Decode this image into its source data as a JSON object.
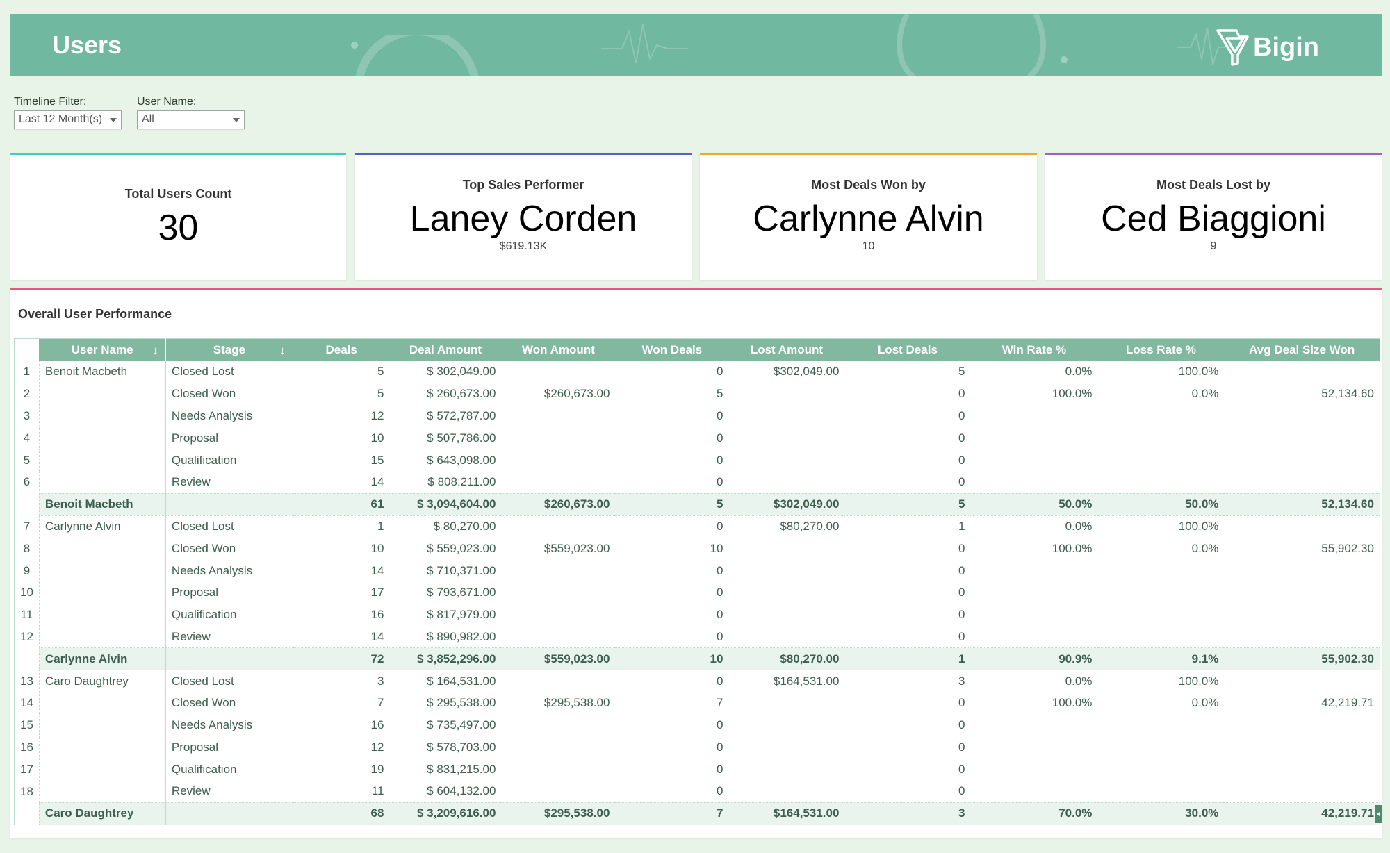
{
  "header": {
    "title": "Users",
    "brand": "Bigin",
    "brand_icon": "funnel-logo-icon",
    "bg_color": "#70b8a0"
  },
  "filters": {
    "timeline": {
      "label": "Timeline Filter:",
      "value": "Last 12 Month(s)"
    },
    "user_name": {
      "label": "User Name:",
      "value": "All"
    }
  },
  "cards": [
    {
      "title": "Total Users Count",
      "value": "30",
      "sub": "",
      "accent": "#3ecfc0"
    },
    {
      "title": "Top Sales Performer",
      "value": "Laney Corden",
      "sub": "$619.13K",
      "accent": "#5560c8"
    },
    {
      "title": "Most Deals Won by",
      "value": "Carlynne Alvin",
      "sub": "10",
      "accent": "#f5a623"
    },
    {
      "title": "Most Deals Lost by",
      "value": "Ced Biaggioni",
      "sub": "9",
      "accent": "#9b5fd6"
    }
  ],
  "panel": {
    "title": "Overall User Performance",
    "accent": "#e5577f",
    "columns": [
      "User Name",
      "Stage",
      "Deals",
      "Deal Amount",
      "Won Amount",
      "Won Deals",
      "Lost Amount",
      "Lost Deals",
      "Win Rate %",
      "Loss Rate %",
      "Avg Deal Size Won"
    ],
    "rows": [
      {
        "type": "row",
        "n": "1",
        "user": "Benoit Macbeth",
        "stage": "Closed Lost",
        "deals": "5",
        "deal_amount": "$ 302,049.00",
        "won_amount": "",
        "won_deals": "0",
        "lost_amount": "$302,049.00",
        "lost_deals": "5",
        "win_rate": "0.0%",
        "loss_rate": "100.0%",
        "avg": ""
      },
      {
        "type": "row",
        "n": "2",
        "user": "",
        "stage": "Closed Won",
        "deals": "5",
        "deal_amount": "$ 260,673.00",
        "won_amount": "$260,673.00",
        "won_deals": "5",
        "lost_amount": "",
        "lost_deals": "0",
        "win_rate": "100.0%",
        "loss_rate": "0.0%",
        "avg": "52,134.60"
      },
      {
        "type": "row",
        "n": "3",
        "user": "",
        "stage": "Needs Analysis",
        "deals": "12",
        "deal_amount": "$ 572,787.00",
        "won_amount": "",
        "won_deals": "0",
        "lost_amount": "",
        "lost_deals": "0",
        "win_rate": "",
        "loss_rate": "",
        "avg": ""
      },
      {
        "type": "row",
        "n": "4",
        "user": "",
        "stage": "Proposal",
        "deals": "10",
        "deal_amount": "$ 507,786.00",
        "won_amount": "",
        "won_deals": "0",
        "lost_amount": "",
        "lost_deals": "0",
        "win_rate": "",
        "loss_rate": "",
        "avg": ""
      },
      {
        "type": "row",
        "n": "5",
        "user": "",
        "stage": "Qualification",
        "deals": "15",
        "deal_amount": "$ 643,098.00",
        "won_amount": "",
        "won_deals": "0",
        "lost_amount": "",
        "lost_deals": "0",
        "win_rate": "",
        "loss_rate": "",
        "avg": ""
      },
      {
        "type": "row",
        "n": "6",
        "user": "",
        "stage": "Review",
        "deals": "14",
        "deal_amount": "$ 808,211.00",
        "won_amount": "",
        "won_deals": "0",
        "lost_amount": "",
        "lost_deals": "0",
        "win_rate": "",
        "loss_rate": "",
        "avg": ""
      },
      {
        "type": "sub",
        "n": "",
        "user": "Benoit Macbeth",
        "stage": "",
        "deals": "61",
        "deal_amount": "$ 3,094,604.00",
        "won_amount": "$260,673.00",
        "won_deals": "5",
        "lost_amount": "$302,049.00",
        "lost_deals": "5",
        "win_rate": "50.0%",
        "loss_rate": "50.0%",
        "avg": "52,134.60"
      },
      {
        "type": "row",
        "n": "7",
        "user": "Carlynne Alvin",
        "stage": "Closed Lost",
        "deals": "1",
        "deal_amount": "$ 80,270.00",
        "won_amount": "",
        "won_deals": "0",
        "lost_amount": "$80,270.00",
        "lost_deals": "1",
        "win_rate": "0.0%",
        "loss_rate": "100.0%",
        "avg": ""
      },
      {
        "type": "row",
        "n": "8",
        "user": "",
        "stage": "Closed Won",
        "deals": "10",
        "deal_amount": "$ 559,023.00",
        "won_amount": "$559,023.00",
        "won_deals": "10",
        "lost_amount": "",
        "lost_deals": "0",
        "win_rate": "100.0%",
        "loss_rate": "0.0%",
        "avg": "55,902.30"
      },
      {
        "type": "row",
        "n": "9",
        "user": "",
        "stage": "Needs Analysis",
        "deals": "14",
        "deal_amount": "$ 710,371.00",
        "won_amount": "",
        "won_deals": "0",
        "lost_amount": "",
        "lost_deals": "0",
        "win_rate": "",
        "loss_rate": "",
        "avg": ""
      },
      {
        "type": "row",
        "n": "10",
        "user": "",
        "stage": "Proposal",
        "deals": "17",
        "deal_amount": "$ 793,671.00",
        "won_amount": "",
        "won_deals": "0",
        "lost_amount": "",
        "lost_deals": "0",
        "win_rate": "",
        "loss_rate": "",
        "avg": ""
      },
      {
        "type": "row",
        "n": "11",
        "user": "",
        "stage": "Qualification",
        "deals": "16",
        "deal_amount": "$ 817,979.00",
        "won_amount": "",
        "won_deals": "0",
        "lost_amount": "",
        "lost_deals": "0",
        "win_rate": "",
        "loss_rate": "",
        "avg": ""
      },
      {
        "type": "row",
        "n": "12",
        "user": "",
        "stage": "Review",
        "deals": "14",
        "deal_amount": "$ 890,982.00",
        "won_amount": "",
        "won_deals": "0",
        "lost_amount": "",
        "lost_deals": "0",
        "win_rate": "",
        "loss_rate": "",
        "avg": ""
      },
      {
        "type": "sub",
        "n": "",
        "user": "Carlynne Alvin",
        "stage": "",
        "deals": "72",
        "deal_amount": "$ 3,852,296.00",
        "won_amount": "$559,023.00",
        "won_deals": "10",
        "lost_amount": "$80,270.00",
        "lost_deals": "1",
        "win_rate": "90.9%",
        "loss_rate": "9.1%",
        "avg": "55,902.30"
      },
      {
        "type": "row",
        "n": "13",
        "user": "Caro Daughtrey",
        "stage": "Closed Lost",
        "deals": "3",
        "deal_amount": "$ 164,531.00",
        "won_amount": "",
        "won_deals": "0",
        "lost_amount": "$164,531.00",
        "lost_deals": "3",
        "win_rate": "0.0%",
        "loss_rate": "100.0%",
        "avg": ""
      },
      {
        "type": "row",
        "n": "14",
        "user": "",
        "stage": "Closed Won",
        "deals": "7",
        "deal_amount": "$ 295,538.00",
        "won_amount": "$295,538.00",
        "won_deals": "7",
        "lost_amount": "",
        "lost_deals": "0",
        "win_rate": "100.0%",
        "loss_rate": "0.0%",
        "avg": "42,219.71"
      },
      {
        "type": "row",
        "n": "15",
        "user": "",
        "stage": "Needs Analysis",
        "deals": "16",
        "deal_amount": "$ 735,497.00",
        "won_amount": "",
        "won_deals": "0",
        "lost_amount": "",
        "lost_deals": "0",
        "win_rate": "",
        "loss_rate": "",
        "avg": ""
      },
      {
        "type": "row",
        "n": "16",
        "user": "",
        "stage": "Proposal",
        "deals": "12",
        "deal_amount": "$ 578,703.00",
        "won_amount": "",
        "won_deals": "0",
        "lost_amount": "",
        "lost_deals": "0",
        "win_rate": "",
        "loss_rate": "",
        "avg": ""
      },
      {
        "type": "row",
        "n": "17",
        "user": "",
        "stage": "Qualification",
        "deals": "19",
        "deal_amount": "$ 831,215.00",
        "won_amount": "",
        "won_deals": "0",
        "lost_amount": "",
        "lost_deals": "0",
        "win_rate": "",
        "loss_rate": "",
        "avg": ""
      },
      {
        "type": "row",
        "n": "18",
        "user": "",
        "stage": "Review",
        "deals": "11",
        "deal_amount": "$ 604,132.00",
        "won_amount": "",
        "won_deals": "0",
        "lost_amount": "",
        "lost_deals": "0",
        "win_rate": "",
        "loss_rate": "",
        "avg": ""
      },
      {
        "type": "sub",
        "n": "",
        "user": "Caro Daughtrey",
        "stage": "",
        "deals": "68",
        "deal_amount": "$ 3,209,616.00",
        "won_amount": "$295,538.00",
        "won_deals": "7",
        "lost_amount": "$164,531.00",
        "lost_deals": "3",
        "win_rate": "70.0%",
        "loss_rate": "30.0%",
        "avg": "42,219.71"
      }
    ]
  }
}
